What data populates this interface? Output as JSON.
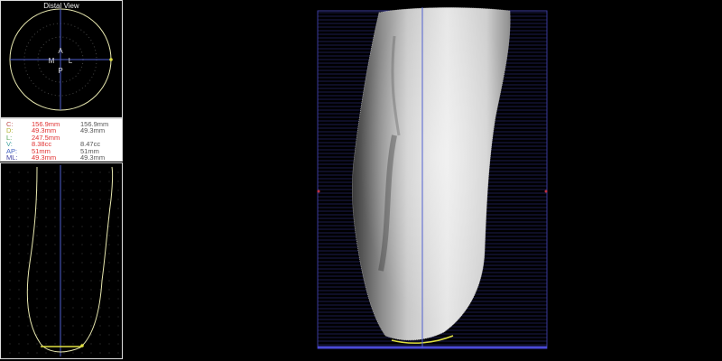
{
  "distal_view": {
    "title": "Distal View",
    "labels": {
      "anterior": "A",
      "posterior": "P",
      "medial": "M",
      "lateral": "L"
    }
  },
  "stats": [
    {
      "label": "C:",
      "value": "156.9mm",
      "ref": "156.9mm",
      "color": "#c05050"
    },
    {
      "label": "D:",
      "value": "49.3mm",
      "ref": "49.3mm",
      "color": "#b0b030"
    },
    {
      "label": "L:",
      "value": "247.5mm",
      "ref": "",
      "color": "#50a050"
    },
    {
      "label": "V:",
      "value": "8.38cc",
      "ref": "8.47cc",
      "color": "#40a0a0"
    },
    {
      "label": "AP:",
      "value": "51mm",
      "ref": "51mm",
      "color": "#4060c0"
    },
    {
      "label": "ML:",
      "value": "49.3mm",
      "ref": "49.3mm",
      "color": "#4040a0"
    }
  ],
  "colors": {
    "value_text": "#e03030",
    "grid_lines": "#3a3a9a",
    "outline": "#e8e8b0",
    "center_axis": "#5060d0",
    "marker": "#e0e040",
    "side_marker": "#c03040"
  },
  "icons": [
    "distal-outline-icon",
    "profile-outline-icon",
    "limb-model-icon"
  ]
}
